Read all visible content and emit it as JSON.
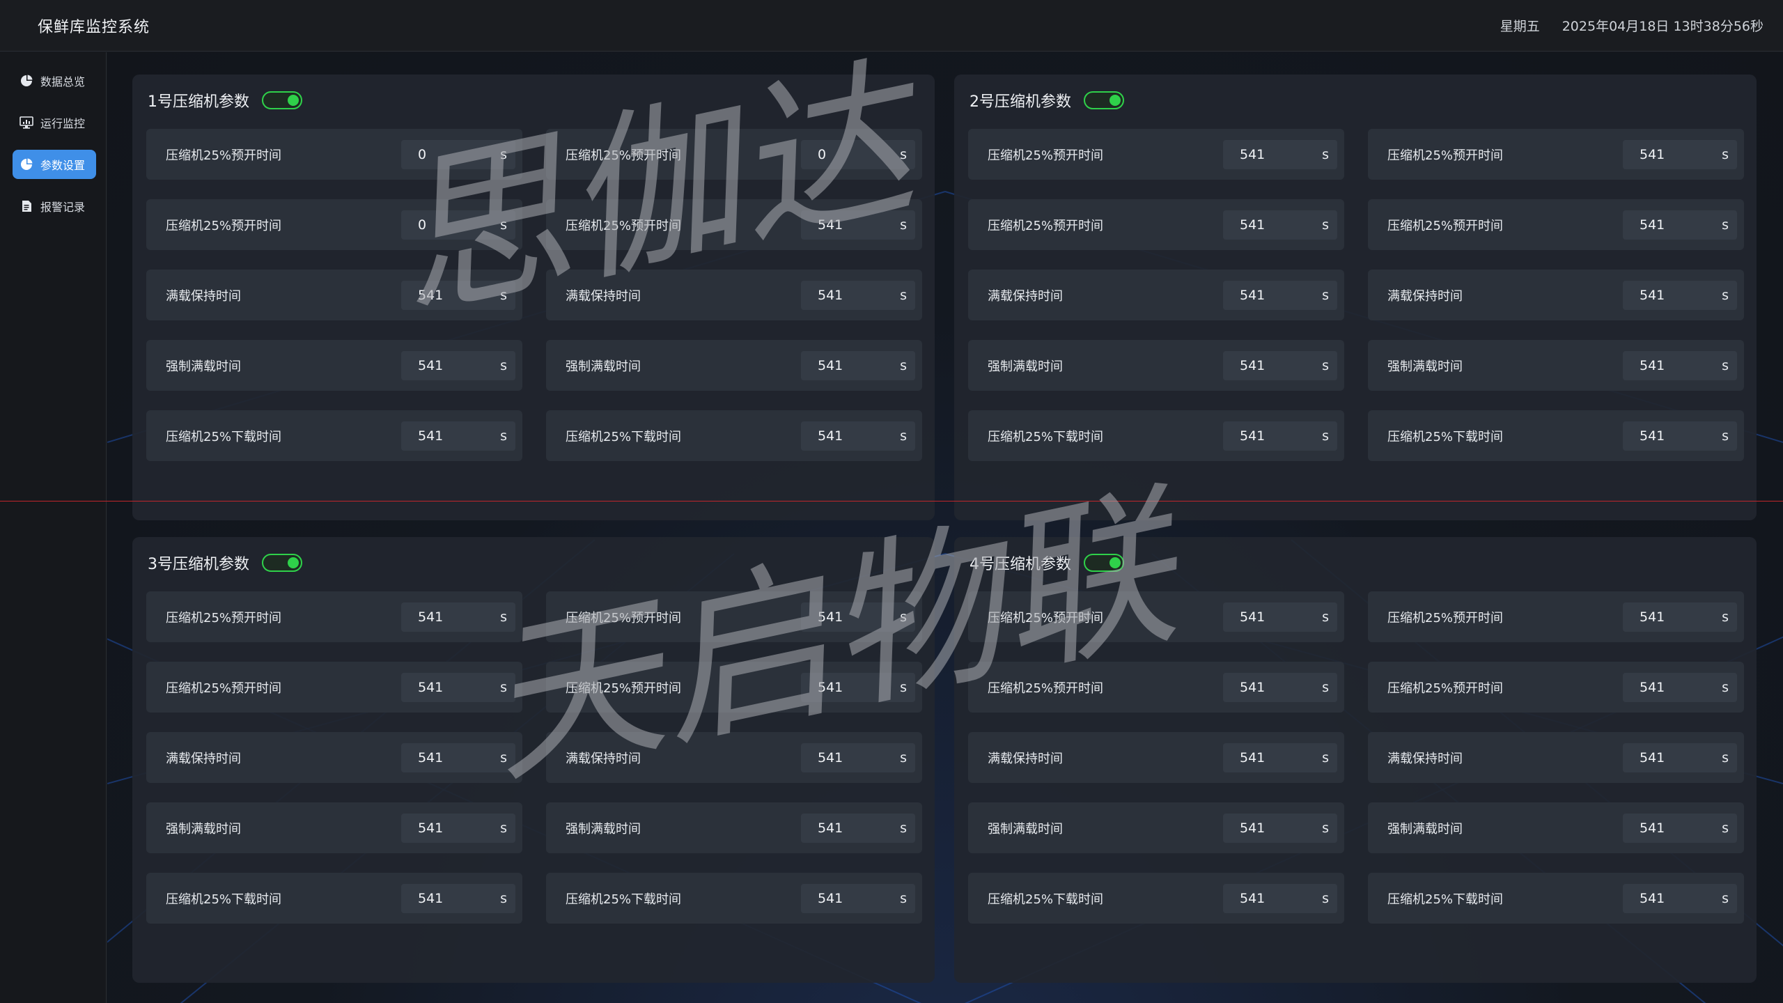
{
  "header": {
    "title": "保鲜库监控系统",
    "weekday": "星期五",
    "datetime": "2025年04月18日 13时38分56秒"
  },
  "sidebar": {
    "items": [
      {
        "label": "数据总览",
        "icon": "pie-chart-icon",
        "active": false
      },
      {
        "label": "运行监控",
        "icon": "monitor-icon",
        "active": false
      },
      {
        "label": "参数设置",
        "icon": "pie-chart-icon",
        "active": true
      },
      {
        "label": "报警记录",
        "icon": "document-icon",
        "active": false
      }
    ]
  },
  "panels": [
    {
      "title": "1号压缩机参数",
      "enabled": true,
      "params": [
        {
          "label": "压缩机25%预开时间",
          "value": "0",
          "unit": "s"
        },
        {
          "label": "压缩机25%预开时间",
          "value": "0",
          "unit": "s"
        },
        {
          "label": "压缩机25%预开时间",
          "value": "0",
          "unit": "s"
        },
        {
          "label": "压缩机25%预开时间",
          "value": "541",
          "unit": "s"
        },
        {
          "label": "满载保持时间",
          "value": "541",
          "unit": "s"
        },
        {
          "label": "满载保持时间",
          "value": "541",
          "unit": "s"
        },
        {
          "label": "强制满载时间",
          "value": "541",
          "unit": "s"
        },
        {
          "label": "强制满载时间",
          "value": "541",
          "unit": "s"
        },
        {
          "label": "压缩机25%下载时间",
          "value": "541",
          "unit": "s"
        },
        {
          "label": "压缩机25%下载时间",
          "value": "541",
          "unit": "s"
        }
      ]
    },
    {
      "title": "2号压缩机参数",
      "enabled": true,
      "params": [
        {
          "label": "压缩机25%预开时间",
          "value": "541",
          "unit": "s"
        },
        {
          "label": "压缩机25%预开时间",
          "value": "541",
          "unit": "s"
        },
        {
          "label": "压缩机25%预开时间",
          "value": "541",
          "unit": "s"
        },
        {
          "label": "压缩机25%预开时间",
          "value": "541",
          "unit": "s"
        },
        {
          "label": "满载保持时间",
          "value": "541",
          "unit": "s"
        },
        {
          "label": "满载保持时间",
          "value": "541",
          "unit": "s"
        },
        {
          "label": "强制满载时间",
          "value": "541",
          "unit": "s"
        },
        {
          "label": "强制满载时间",
          "value": "541",
          "unit": "s"
        },
        {
          "label": "压缩机25%下载时间",
          "value": "541",
          "unit": "s"
        },
        {
          "label": "压缩机25%下载时间",
          "value": "541",
          "unit": "s"
        }
      ]
    },
    {
      "title": "3号压缩机参数",
      "enabled": true,
      "params": [
        {
          "label": "压缩机25%预开时间",
          "value": "541",
          "unit": "s"
        },
        {
          "label": "压缩机25%预开时间",
          "value": "541",
          "unit": "s"
        },
        {
          "label": "压缩机25%预开时间",
          "value": "541",
          "unit": "s"
        },
        {
          "label": "压缩机25%预开时间",
          "value": "541",
          "unit": "s"
        },
        {
          "label": "满载保持时间",
          "value": "541",
          "unit": "s"
        },
        {
          "label": "满载保持时间",
          "value": "541",
          "unit": "s"
        },
        {
          "label": "强制满载时间",
          "value": "541",
          "unit": "s"
        },
        {
          "label": "强制满载时间",
          "value": "541",
          "unit": "s"
        },
        {
          "label": "压缩机25%下载时间",
          "value": "541",
          "unit": "s"
        },
        {
          "label": "压缩机25%下载时间",
          "value": "541",
          "unit": "s"
        }
      ]
    },
    {
      "title": "4号压缩机参数",
      "enabled": true,
      "params": [
        {
          "label": "压缩机25%预开时间",
          "value": "541",
          "unit": "s"
        },
        {
          "label": "压缩机25%预开时间",
          "value": "541",
          "unit": "s"
        },
        {
          "label": "压缩机25%预开时间",
          "value": "541",
          "unit": "s"
        },
        {
          "label": "压缩机25%预开时间",
          "value": "541",
          "unit": "s"
        },
        {
          "label": "满载保持时间",
          "value": "541",
          "unit": "s"
        },
        {
          "label": "满载保持时间",
          "value": "541",
          "unit": "s"
        },
        {
          "label": "强制满载时间",
          "value": "541",
          "unit": "s"
        },
        {
          "label": "强制满载时间",
          "value": "541",
          "unit": "s"
        },
        {
          "label": "压缩机25%下载时间",
          "value": "541",
          "unit": "s"
        },
        {
          "label": "压缩机25%下载时间",
          "value": "541",
          "unit": "s"
        }
      ]
    }
  ],
  "watermarks": [
    "思伽达",
    "天启物联"
  ],
  "colors": {
    "accent": "#3f8fe8",
    "toggle_on": "#2fd14a",
    "divider_red": "#c0262b"
  }
}
